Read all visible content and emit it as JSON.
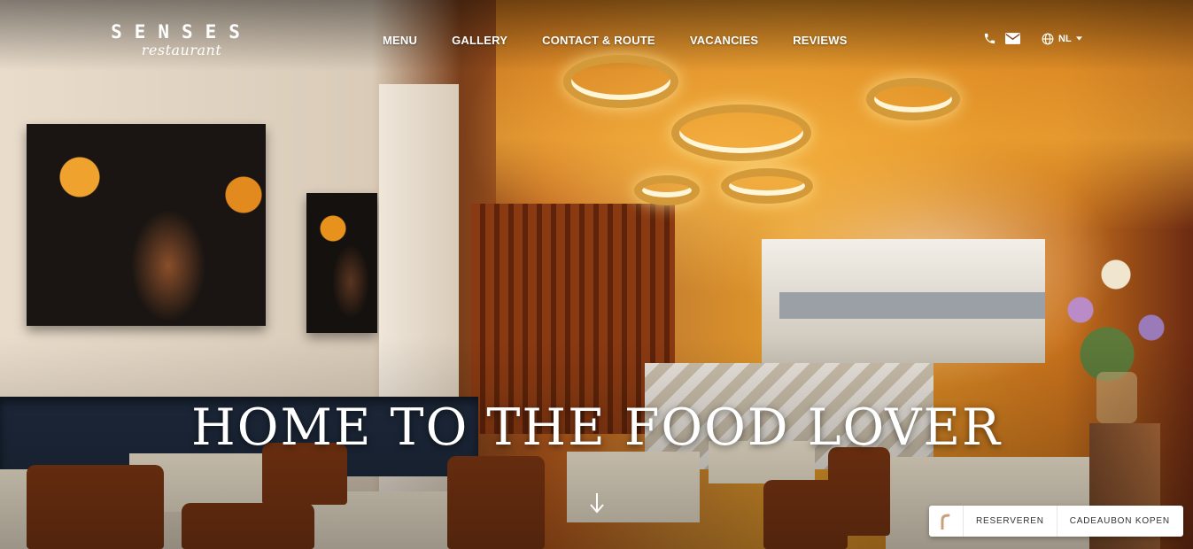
{
  "brand": {
    "name": "SENSES",
    "subtitle": "restaurant"
  },
  "nav": [
    {
      "label": "MENU"
    },
    {
      "label": "GALLERY"
    },
    {
      "label": "CONTACT & ROUTE"
    },
    {
      "label": "VACANCIES"
    },
    {
      "label": "REVIEWS"
    }
  ],
  "utilities": {
    "phone_icon": "phone-icon",
    "email_icon": "envelope-icon",
    "globe_icon": "globe-icon",
    "language": "NL"
  },
  "hero": {
    "headline": "HOME TO THE FOOD LOVER",
    "scroll_icon": "arrow-down-icon"
  },
  "booking_widget": {
    "reserve_label": "RESERVEREN",
    "voucher_label": "CADEAUBON KOPEN",
    "accent": "#c8a07a"
  }
}
